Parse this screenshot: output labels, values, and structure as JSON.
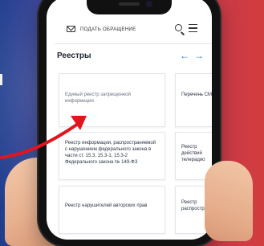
{
  "header": {
    "submit_label": "ПОДАТЬ ОБРАЩЕНИЕ"
  },
  "section": {
    "title": "Реестры"
  },
  "cards": [
    {
      "label": "Единый реестр запрещенной информации"
    },
    {
      "label": "Перечень СМИ"
    },
    {
      "label": "Реестр информации, распространяемой с нарушением федерального закона в части ст. 15.3, 15.3-1, 15.3-2 Федерального закона № 149-ФЗ"
    },
    {
      "label": "Реестр действий телерадио"
    },
    {
      "label": "Реестр нарушителей авторских прав"
    },
    {
      "label": "Реестр распространи"
    }
  ],
  "icons": {
    "mail": "mail-icon",
    "search": "search-icon",
    "menu": "menu-icon",
    "prev": "arrow-left-icon",
    "next": "arrow-right-icon"
  },
  "colors": {
    "accent": "#2e7ec3",
    "highlight_arrow": "#e0161e"
  }
}
